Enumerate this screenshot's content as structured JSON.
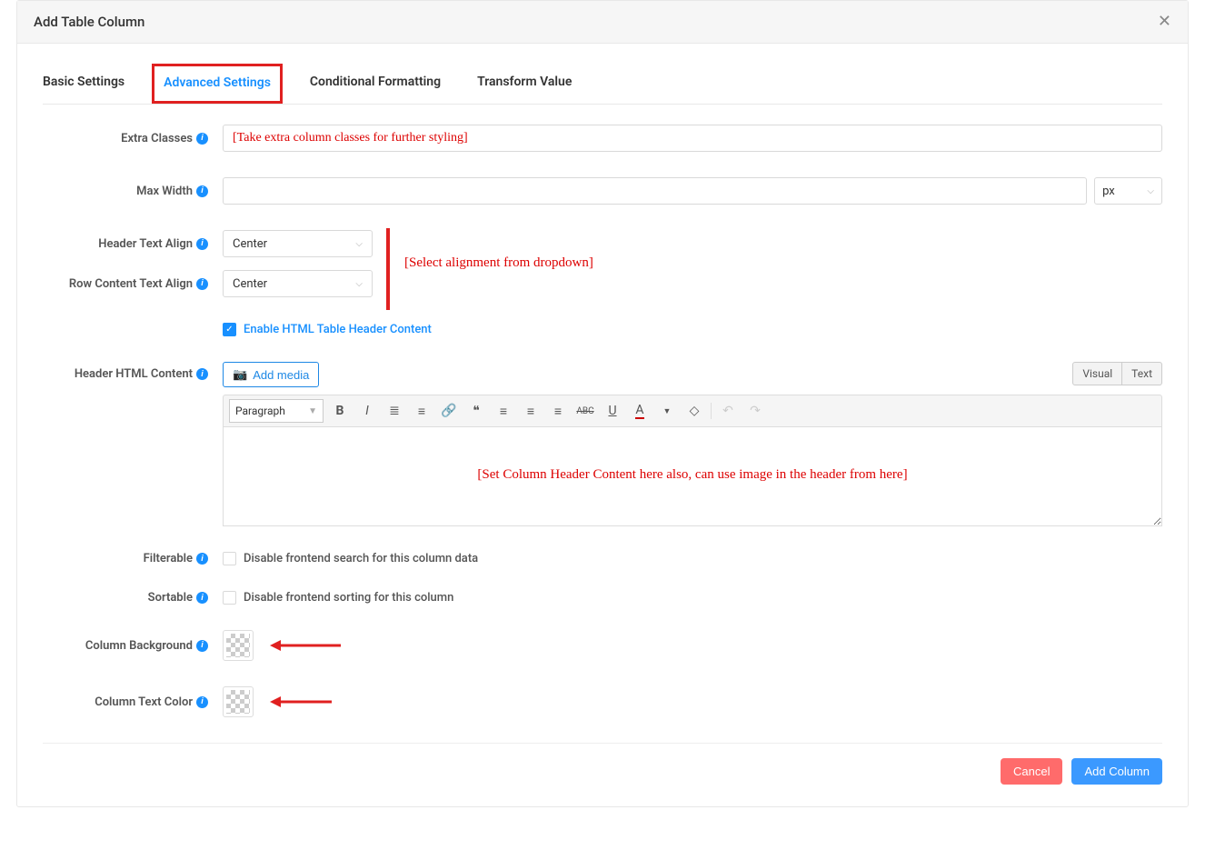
{
  "dialog": {
    "title": "Add Table Column"
  },
  "tabs": {
    "basic": "Basic Settings",
    "advanced": "Advanced Settings",
    "conditional": "Conditional Formatting",
    "transform": "Transform Value"
  },
  "labels": {
    "extra_classes": "Extra Classes",
    "max_width": "Max Width",
    "header_align": "Header Text Align",
    "row_align": "Row Content Text Align",
    "enable_html_header": "Enable HTML Table Header Content",
    "header_html_content": "Header HTML Content",
    "filterable": "Filterable",
    "sortable": "Sortable",
    "column_bg": "Column Background",
    "column_text_color": "Column Text Color"
  },
  "values": {
    "extra_classes_annot": "[Take extra column classes for further styling]",
    "max_width": "",
    "max_width_unit": "px",
    "header_align": "Center",
    "row_align": "Center",
    "enable_html_header_checked": true,
    "filterable_checked": false,
    "filterable_label": "Disable frontend search for this column data",
    "sortable_checked": false,
    "sortable_label": "Disable frontend sorting for this column",
    "align_annot": "[Select alignment from dropdown]",
    "editor_annot": "[Set Column Header Content here also, can use image in the header from here]"
  },
  "editor": {
    "add_media": "Add media",
    "visual_tab": "Visual",
    "text_tab": "Text",
    "format_select": "Paragraph"
  },
  "footer": {
    "cancel": "Cancel",
    "submit": "Add Column"
  }
}
